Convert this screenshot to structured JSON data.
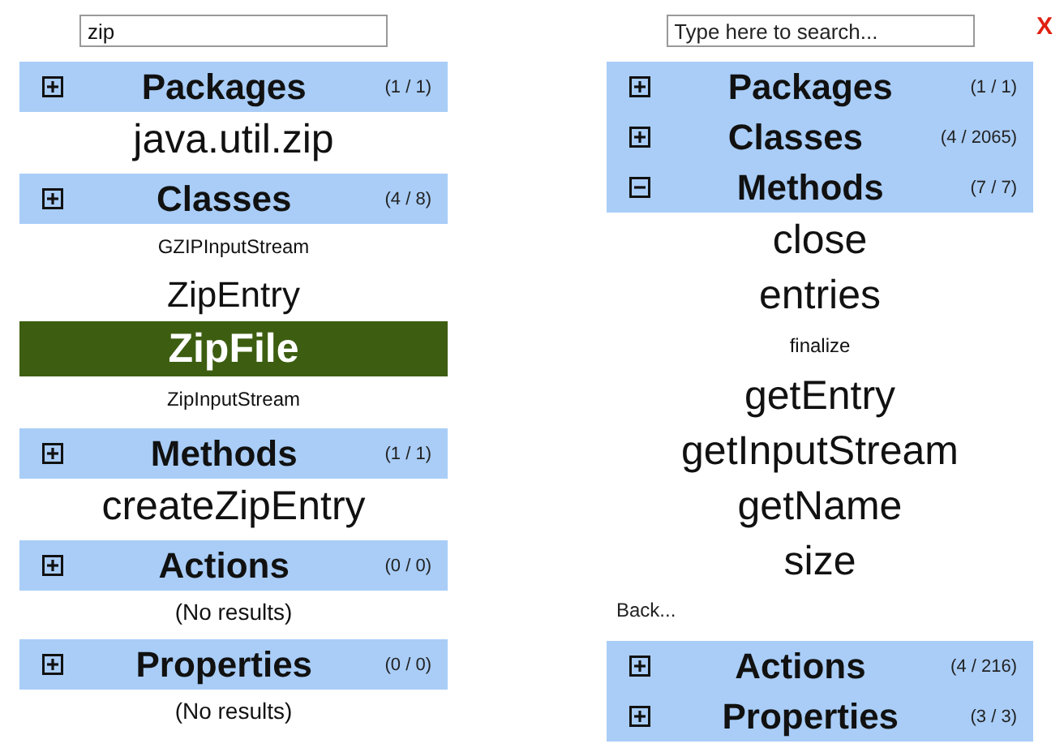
{
  "panels": [
    {
      "search": {
        "value": "zip"
      },
      "sections": [
        {
          "title": "Packages",
          "count": "(1 / 1)",
          "expanded": false,
          "items": [
            {
              "label": "java.util.zip",
              "kind": "big",
              "selected": false
            }
          ]
        },
        {
          "title": "Classes",
          "count": "(4 / 8)",
          "expanded": false,
          "items": [
            {
              "label": "GZIPInputStream",
              "kind": "small",
              "selected": false
            },
            {
              "label": "ZipEntry",
              "kind": "medium",
              "selected": false
            },
            {
              "label": "ZipFile",
              "kind": "big",
              "selected": true
            },
            {
              "label": "ZipInputStream",
              "kind": "small",
              "selected": false
            }
          ]
        },
        {
          "title": "Methods",
          "count": "(1 / 1)",
          "expanded": false,
          "items": [
            {
              "label": "createZipEntry",
              "kind": "big",
              "selected": false
            }
          ]
        },
        {
          "title": "Actions",
          "count": "(0 / 0)",
          "expanded": false,
          "items": [
            {
              "label": "(No results)",
              "kind": "note",
              "selected": false
            }
          ]
        },
        {
          "title": "Properties",
          "count": "(0 / 0)",
          "expanded": false,
          "items": [
            {
              "label": "(No results)",
              "kind": "note",
              "selected": false
            }
          ]
        }
      ]
    },
    {
      "search": {
        "placeholder": "Type here to search..."
      },
      "close": "X",
      "sections": [
        {
          "title": "Packages",
          "count": "(1 / 1)",
          "expanded": false
        },
        {
          "title": "Classes",
          "count": "(4 / 2065)",
          "expanded": false
        },
        {
          "title": "Methods",
          "count": "(7 / 7)",
          "expanded": true,
          "items": [
            {
              "label": "close",
              "kind": "big",
              "selected": false
            },
            {
              "label": "entries",
              "kind": "big",
              "selected": false
            },
            {
              "label": "finalize",
              "kind": "small",
              "selected": false
            },
            {
              "label": "getEntry",
              "kind": "big",
              "selected": false
            },
            {
              "label": "getInputStream",
              "kind": "big",
              "selected": false
            },
            {
              "label": "getName",
              "kind": "big",
              "selected": false
            },
            {
              "label": "size",
              "kind": "big",
              "selected": false
            }
          ],
          "back": "Back..."
        },
        {
          "title": "Actions",
          "count": "(4 / 216)",
          "expanded": false
        },
        {
          "title": "Properties",
          "count": "(3 / 3)",
          "expanded": false
        }
      ]
    }
  ]
}
